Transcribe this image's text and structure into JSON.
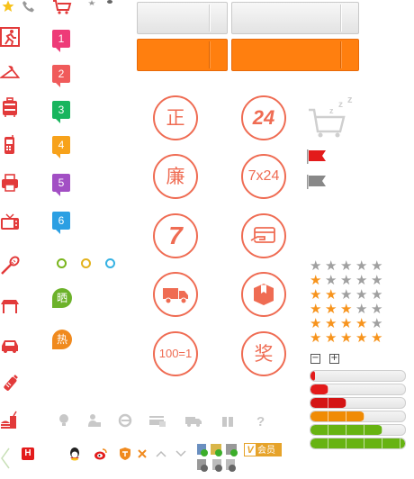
{
  "colors": {
    "icon_red": "#e23a3a",
    "circle_accent": "#ef6c53",
    "orange_button": "#ff7f0f",
    "star_on": "#f7941d",
    "star_off": "#a0a0a0"
  },
  "numbered_badges": [
    {
      "label": "1",
      "color": "#ee3b78"
    },
    {
      "label": "2",
      "color": "#f05b5b"
    },
    {
      "label": "3",
      "color": "#19b55e"
    },
    {
      "label": "4",
      "color": "#f7a21b"
    },
    {
      "label": "5",
      "color": "#a24fc4"
    },
    {
      "label": "6",
      "color": "#2b9fe3"
    }
  ],
  "tag_badges": [
    {
      "label": "晒",
      "color": "#6cb22a"
    },
    {
      "label": "热",
      "color": "#f08a1e"
    }
  ],
  "circle_badges": {
    "zheng": "正",
    "hour24": "24",
    "lian": "廉",
    "full_service": "7x24",
    "seven_day": "7",
    "hundred_one": "100=1",
    "jiang": "奖"
  },
  "rating": {
    "rows": [
      0,
      1,
      2,
      3,
      4,
      5
    ],
    "max": 5,
    "minus_label": "−",
    "plus_label": "+"
  },
  "progress_bars": [
    {
      "value": 0.05,
      "color": "#e31b1b"
    },
    {
      "value": 0.19,
      "color": "#e31b1b"
    },
    {
      "value": 0.38,
      "color": "#d41414"
    },
    {
      "value": 0.57,
      "color": "#f08b05"
    },
    {
      "value": 0.76,
      "color": "#67b312"
    },
    {
      "value": 1.0,
      "color": "#67b312"
    }
  ],
  "color_dots": [
    "#7ab51d",
    "#e3b21d",
    "#35b2e3"
  ],
  "vip_badge": {
    "mark": "V",
    "label": "会员",
    "color": "#e6a32a"
  },
  "small_badge_h": "H",
  "bottom_icons": [
    "bulb-icon",
    "user-lock-icon",
    "ie-icon",
    "card-icon",
    "truck-icon",
    "gift-icon",
    "question-icon"
  ]
}
